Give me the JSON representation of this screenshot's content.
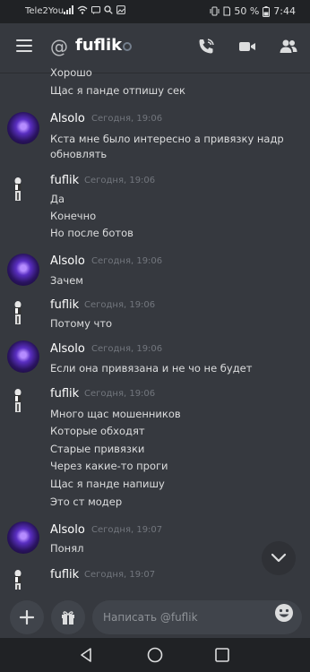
{
  "status_bar": {
    "carrier": "Tele2You",
    "battery": "50 %",
    "time": "7:44"
  },
  "header": {
    "title": "fuflik",
    "prefix_icon": "at-icon",
    "actions": [
      "call-icon",
      "video-icon",
      "members-icon"
    ]
  },
  "messages": {
    "top_lines": [
      "Хорошо",
      "Щас я панде отпишу сек"
    ],
    "groups": [
      {
        "author": "Alsolo",
        "time": "Сегодня, 19:06",
        "lines": [
          "Кста мне было интересно а привязку надр",
          "обновлять"
        ]
      },
      {
        "author": "fuflik",
        "time": "Сегодня, 19:06",
        "lines": [
          "Да",
          "Конечно",
          "Но после ботов"
        ]
      },
      {
        "author": "Alsolo",
        "time": "Сегодня, 19:06",
        "lines": [
          "Зачем"
        ]
      },
      {
        "author": "fuflik",
        "time": "Сегодня, 19:06",
        "lines": [
          "Потому что"
        ]
      },
      {
        "author": "Alsolo",
        "time": "Сегодня, 19:06",
        "lines": [
          "Если она привязана и не чо не будет"
        ]
      },
      {
        "author": "fuflik",
        "time": "Сегодня, 19:06",
        "lines": [
          "Много щас мошенников",
          "Которые обходят",
          "Старые привязки",
          "Через какие-то проги",
          "Щас я панде напишу",
          "Это ст модер"
        ]
      },
      {
        "author": "Alsolo",
        "time": "Сегодня, 19:07",
        "lines": [
          "Понял"
        ]
      },
      {
        "author": "fuflik",
        "time": "Сегодня, 19:07",
        "lines": []
      }
    ]
  },
  "composer": {
    "placeholder": "Написать @fuflik"
  },
  "colors": {
    "background": "#36393f",
    "bar": "#202225",
    "input": "#40444b",
    "muted": "#72767d"
  }
}
